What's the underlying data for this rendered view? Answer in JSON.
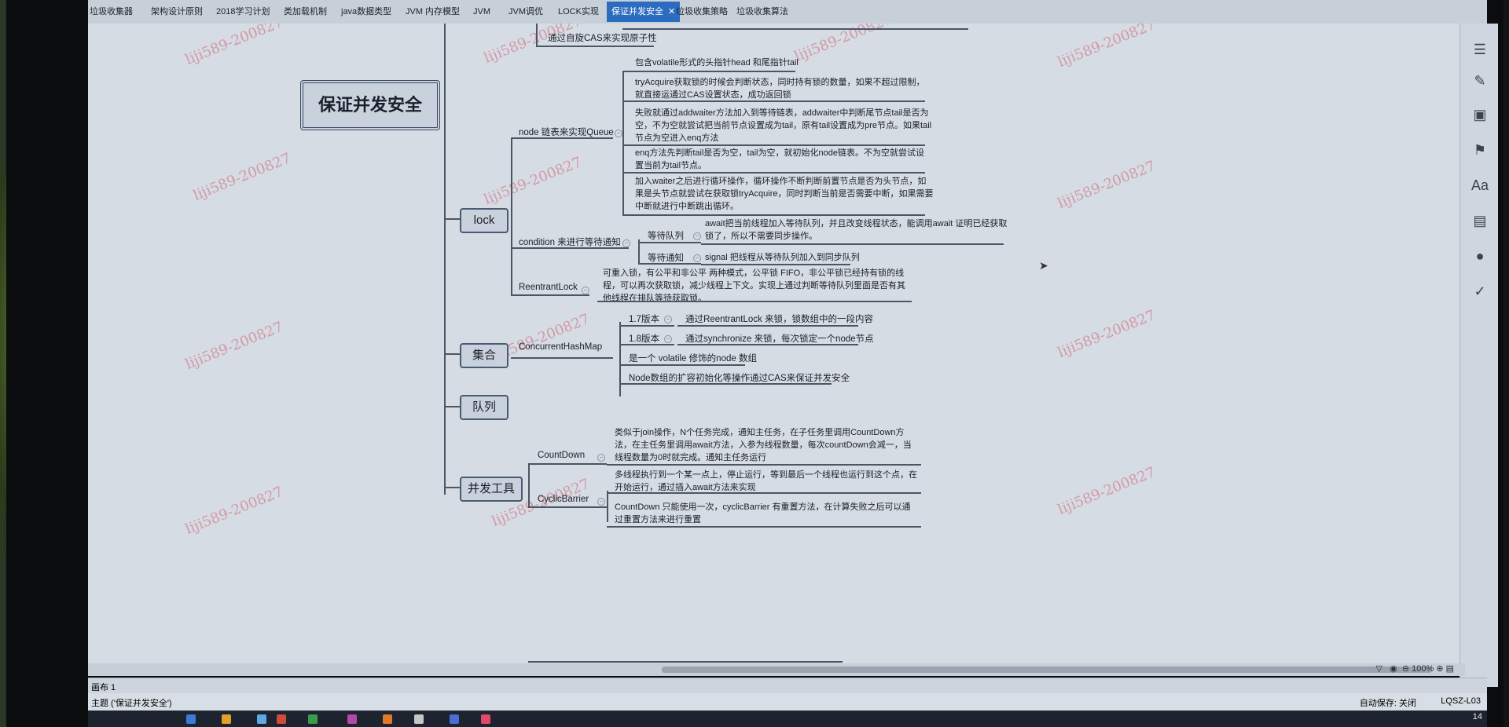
{
  "tabs": [
    {
      "label": "垃圾收集器"
    },
    {
      "label": "架构设计原则"
    },
    {
      "label": "2018学习计划"
    },
    {
      "label": "类加载机制"
    },
    {
      "label": "java数据类型"
    },
    {
      "label": "JVM 内存模型"
    },
    {
      "label": "JVM"
    },
    {
      "label": "JVM调优"
    },
    {
      "label": "LOCK实现"
    },
    {
      "label": "保证并发安全",
      "active": true
    },
    {
      "label": "垃圾收集策略"
    },
    {
      "label": "垃圾收集算法"
    }
  ],
  "tab_close": "✕",
  "mindmap": {
    "root": "保证并发安全",
    "top_partial": "通过自旋CAS来实现原子性",
    "branches": {
      "lock": "lock",
      "set": "集合",
      "queue": "队列",
      "tools": "并发工具"
    },
    "lock_children": {
      "node_queue": "node 链表来实现Queue",
      "condition": "condition 来进行等待通知",
      "reentrant": "ReentrantLock"
    },
    "node_queue_items": [
      "包含volatile形式的头指针head 和尾指针tail",
      "tryAcquire获取锁的时候会判断状态，同时持有锁的数量，如果不超过限制，就直接运通过CAS设置状态，成功返回锁",
      "失败就通过addwaiter方法加入到等待链表，addwaiter中判断尾节点tail是否为空，不为空就尝试把当前节点设置成为tail，原有tail设置成为pre节点。如果tail节点为空进入enq方法",
      "enq方法先判断tail是否为空，tail为空，就初始化node链表。不为空就尝试设置当前为tail节点。",
      "加入waiter之后进行循环操作，循环操作不断判断前置节点是否为头节点，如果是头节点就尝试在获取锁tryAcquire，同时判断当前是否需要中断，如果需要中断就进行中断跳出循环。"
    ],
    "condition_items": [
      {
        "label": "等待队列",
        "text": "await把当前线程加入等待队列，并且改变线程状态，能调用await 证明已经获取锁了，所以不需要同步操作。"
      },
      {
        "label": "等待通知",
        "text": "signal 把线程从等待队列加入到同步队列"
      }
    ],
    "reentrant_text": "可重入锁，有公平和非公平 两种模式，公平锁 FIFO，非公平锁已经持有锁的线程，可以再次获取锁，减少线程上下文。实现上通过判断等待队列里面是否有其他线程在排队等待获取锁。",
    "chm": "ConcurrentHashMap",
    "chm_items": [
      {
        "label": "1.7版本",
        "text": "通过ReentrantLock 来锁，锁数组中的一段内容"
      },
      {
        "label": "1.8版本",
        "text": "通过synchronize 来锁，每次锁定一个node节点"
      },
      {
        "label": "是一个 volatile 修饰的node 数组"
      },
      {
        "label": "Node数组的扩容初始化等操作通过CAS来保证并发安全"
      }
    ],
    "countdown": "CountDown",
    "countdown_text": "类似于join操作，N个任务完成，通知主任务，在子任务里调用CountDown方法，在主任务里调用await方法，入参为线程数量，每次countDown会减一，当线程数量为0时就完成。通知主任务运行",
    "cyclic": "CyclicBarrier",
    "cyclic_items": [
      "多线程执行到一个某一点上，停止运行，等到最后一个线程也运行到这个点，在开始运行，通过插入await方法来实现",
      "CountDown 只能使用一次，cyclicBarrier 有重置方法，在计算失败之后可以通过重置方法来进行重置"
    ]
  },
  "watermark": "liji589-200827",
  "zoom": "100%",
  "sheet_label": "画布 1",
  "theme_label": "主题 ('保证并发安全')",
  "autosave": "自动保存: 关闭",
  "user": "LQSZ-L03",
  "clock": "14"
}
